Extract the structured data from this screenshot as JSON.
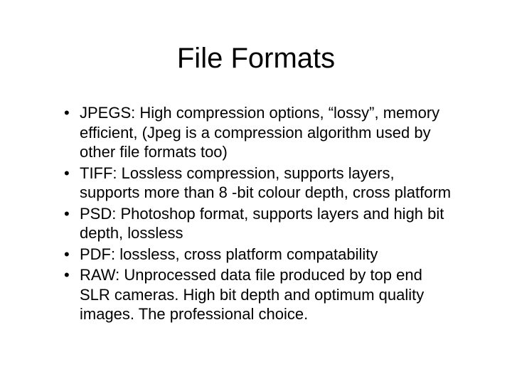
{
  "title": "File Formats",
  "bullets": [
    "JPEGS: High compression options, “lossy”, memory efficient, (Jpeg is a compression algorithm used by other file formats too)",
    "TIFF: Lossless compression, supports layers, supports more than 8 -bit colour depth, cross platform",
    "PSD: Photoshop format, supports layers and high bit depth, lossless",
    "PDF: lossless, cross platform compatability",
    "RAW: Unprocessed data file produced by top end SLR cameras. High bit depth and optimum quality images. The professional choice."
  ]
}
